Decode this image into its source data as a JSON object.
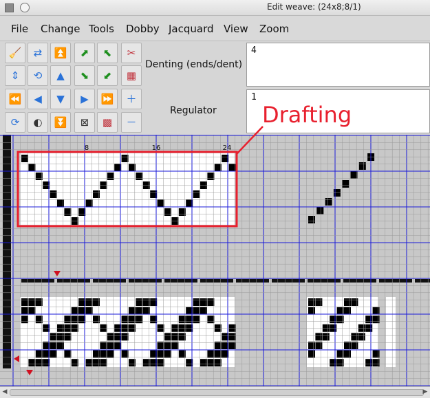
{
  "window": {
    "title": "Edit weave:  (24x8;8/1)"
  },
  "menu": [
    "File",
    "Change",
    "Tools",
    "Dobby",
    "Jacquard",
    "View",
    "Zoom"
  ],
  "denting": {
    "label": "Denting (ends/dent)",
    "value": "4"
  },
  "regulator": {
    "label": "Regulator",
    "value": "1"
  },
  "annotation": {
    "text": "Drafting",
    "color": "#e8202e"
  },
  "draft": {
    "col_labels": [
      "8",
      "16",
      "24"
    ],
    "threading": [
      1,
      2,
      3,
      4,
      5,
      6,
      7,
      8,
      7,
      6,
      5,
      4,
      3,
      2,
      1,
      2,
      3,
      4,
      5,
      6,
      7,
      8,
      7,
      6,
      5,
      4,
      3,
      2,
      1,
      2,
      8,
      7,
      6,
      5,
      4,
      3,
      2,
      1,
      0,
      0,
      0,
      0,
      0,
      0,
      0,
      0,
      0,
      0,
      0,
      0
    ],
    "weave_shape_note": ""
  },
  "colors": {
    "grid_major": "#1a1ad8",
    "grid_minor": "#9a9a9a",
    "highlight_box": "#e8202e",
    "marker": "#d01020"
  }
}
